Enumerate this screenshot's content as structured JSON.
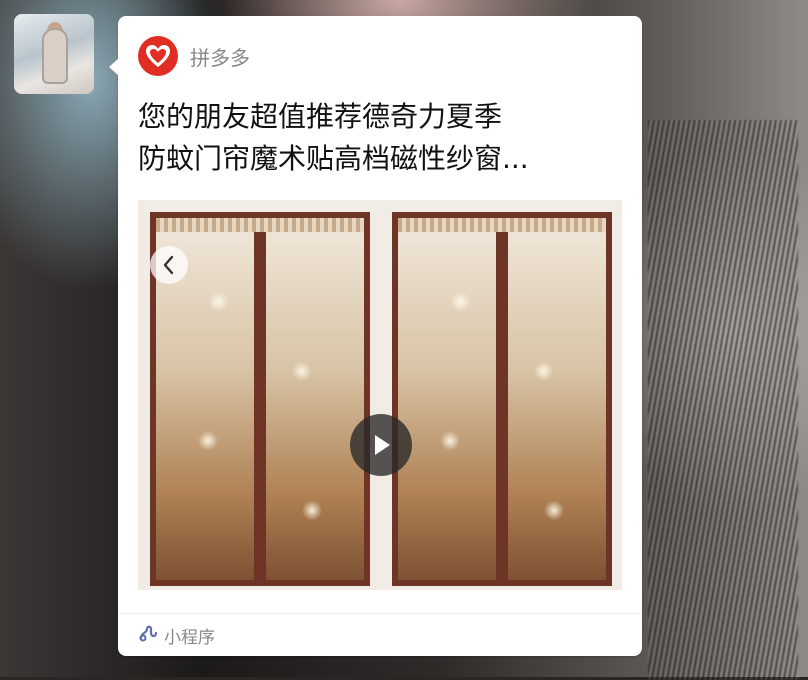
{
  "sender": {
    "avatar": "avatar"
  },
  "card": {
    "app_icon": "pinduoduo-logo",
    "app_name": "拼多多",
    "title_line1": "您的朋友超值推荐德奇力夏季",
    "title_line2": "防蚊门帘魔术贴高档磁性纱窗...",
    "media": {
      "prev_icon": "chevron-left-icon",
      "play_icon": "play-icon"
    },
    "footer": {
      "icon": "mini-program-icon",
      "label": "小程序"
    }
  },
  "colors": {
    "brand": "#e02e24",
    "mini_program": "#5b6fb0"
  }
}
